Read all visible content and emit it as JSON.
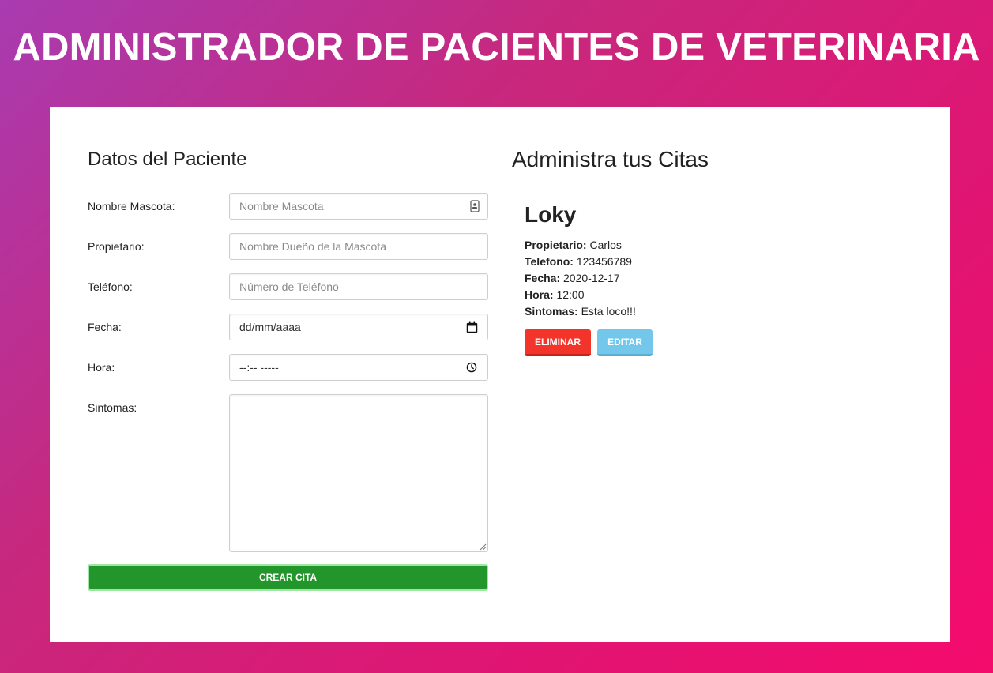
{
  "header": {
    "title": "ADMINISTRADOR DE PACIENTES DE VETERINARIA"
  },
  "form": {
    "heading": "Datos del Paciente",
    "fields": {
      "mascota": {
        "label": "Nombre Mascota:",
        "placeholder": "Nombre Mascota",
        "icon": "contact-card-icon"
      },
      "propietario": {
        "label": "Propietario:",
        "placeholder": "Nombre Dueño de la Mascota"
      },
      "telefono": {
        "label": "Teléfono:",
        "placeholder": "Número de Teléfono"
      },
      "fecha": {
        "label": "Fecha:",
        "value": "dd/mm/aaaa",
        "icon": "calendar-icon"
      },
      "hora": {
        "label": "Hora:",
        "value": "--:-- -----",
        "icon": "clock-icon"
      },
      "sintomas": {
        "label": "Sintomas:",
        "value": ""
      }
    },
    "submit_label": "CREAR CITA"
  },
  "citas": {
    "heading": "Administra tus Citas",
    "items": [
      {
        "mascota": "Loky",
        "propietario_label": "Propietario:",
        "propietario": "Carlos",
        "telefono_label": "Telefono:",
        "telefono": "123456789",
        "fecha_label": "Fecha:",
        "fecha": "2020-12-17",
        "hora_label": "Hora:",
        "hora": "12:00",
        "sintomas_label": "Sintomas:",
        "sintomas": "Esta loco!!!",
        "delete_label": "ELIMINAR",
        "edit_label": "EDITAR"
      }
    ]
  },
  "colors": {
    "create_button": "#22962a",
    "delete_button": "#f2342a",
    "edit_button": "#72c7ea"
  }
}
